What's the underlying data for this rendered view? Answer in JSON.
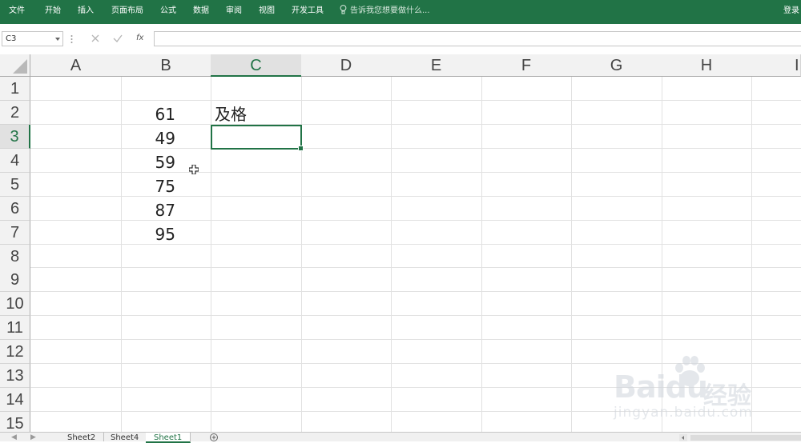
{
  "ribbon": {
    "tabs": [
      "文件",
      "开始",
      "插入",
      "页面布局",
      "公式",
      "数据",
      "审阅",
      "视图",
      "开发工具"
    ],
    "tell_me": "告诉我您想要做什么...",
    "login": "登录",
    "bg_color": "#217346"
  },
  "formula_bar": {
    "name_box": "C3",
    "cancel_icon": "x-icon",
    "enter_icon": "check-icon",
    "function_label": "fx",
    "value": ""
  },
  "grid": {
    "columns": [
      "A",
      "B",
      "C",
      "D",
      "E",
      "F",
      "G",
      "H",
      "I"
    ],
    "selected_column": "C",
    "rows": [
      "1",
      "2",
      "3",
      "4",
      "5",
      "6",
      "7",
      "8",
      "9",
      "10",
      "11",
      "12",
      "13",
      "14",
      "15"
    ],
    "selected_row": "3",
    "cells": {
      "B2": "61",
      "B3": "49",
      "B4": "59",
      "B5": "75",
      "B6": "87",
      "B7": "95",
      "C2": "及格"
    },
    "active_cell": "C3"
  },
  "sheet_tabs": {
    "tabs": [
      "Sheet2",
      "Sheet4",
      "Sheet1"
    ],
    "active": "Sheet1"
  },
  "watermark": {
    "brand": "Baidu",
    "suffix": "经验",
    "url": "jingyan.baidu.com"
  }
}
